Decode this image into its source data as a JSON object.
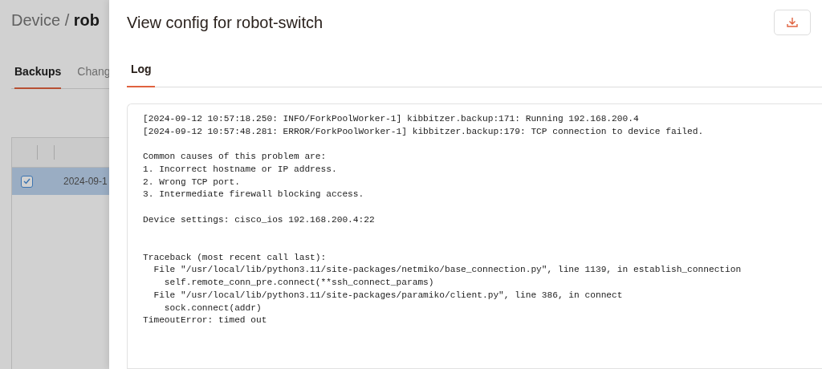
{
  "page": {
    "breadcrumb": "Device / ",
    "title": "rob",
    "tabs": [
      {
        "label": "Backups",
        "selected": true
      },
      {
        "label": "Chang",
        "selected": false
      }
    ],
    "table": {
      "rows": [
        {
          "checked": true,
          "selected": true,
          "date": "2024-09-1"
        }
      ]
    }
  },
  "drawer": {
    "title": "View config for robot-switch",
    "tabs": [
      {
        "label": "Log",
        "selected": true
      }
    ],
    "log": "[2024-09-12 10:57:18.250: INFO/ForkPoolWorker-1] kibbitzer.backup:171: Running 192.168.200.4\n[2024-09-12 10:57:48.281: ERROR/ForkPoolWorker-1] kibbitzer.backup:179: TCP connection to device failed.\n\nCommon causes of this problem are:\n1. Incorrect hostname or IP address.\n2. Wrong TCP port.\n3. Intermediate firewall blocking access.\n\nDevice settings: cisco_ios 192.168.200.4:22\n\n\nTraceback (most recent call last):\n  File \"/usr/local/lib/python3.11/site-packages/netmiko/base_connection.py\", line 1139, in establish_connection\n    self.remote_conn_pre.connect(**ssh_connect_params)\n  File \"/usr/local/lib/python3.11/site-packages/paramiko/client.py\", line 386, in connect\n    sock.connect(addr)\nTimeoutError: timed out"
  }
}
